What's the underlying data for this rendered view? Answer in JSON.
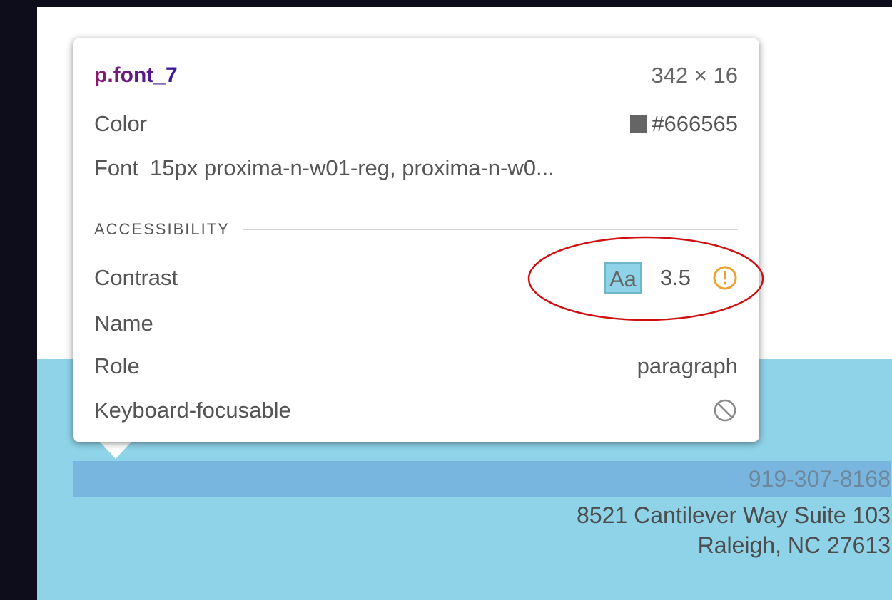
{
  "tooltip": {
    "selector": "p.font_7",
    "dimensions": "342 × 16",
    "color_label": "Color",
    "color_value": "#666565",
    "font_label": "Font",
    "font_value": "15px proxima-n-w01-reg, proxima-n-w0...",
    "accessibility_title": "ACCESSIBILITY",
    "contrast_label": "Contrast",
    "contrast_sample": "Aa",
    "contrast_ratio": "3.5",
    "name_label": "Name",
    "role_label": "Role",
    "role_value": "paragraph",
    "keyboard_label": "Keyboard-focusable",
    "warning_icon": "warning-circle-icon",
    "not_focusable_icon": "no-entry-icon"
  },
  "page": {
    "phone": "919-307-8168",
    "address_line1": "8521 Cantilever Way Suite 103",
    "address_line2": "Raleigh, NC 27613"
  },
  "colors": {
    "swatch": "#666565",
    "band": "#8fd3e8",
    "highlight": "#78b5df",
    "warning": "#f0a030",
    "annotation": "#d01010"
  }
}
